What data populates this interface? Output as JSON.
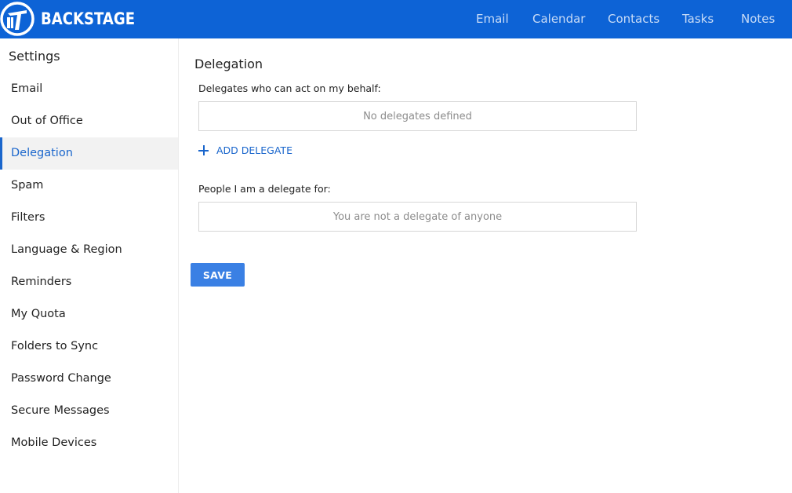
{
  "header": {
    "brand": "BACKSTAGE",
    "logo_icon": "backstage-logo-icon",
    "nav": [
      {
        "label": "Email"
      },
      {
        "label": "Calendar"
      },
      {
        "label": "Contacts"
      },
      {
        "label": "Tasks"
      },
      {
        "label": "Notes"
      }
    ],
    "bar_color": "#0d63d6"
  },
  "sidebar": {
    "title": "Settings",
    "items": [
      {
        "label": "Email"
      },
      {
        "label": "Out of Office"
      },
      {
        "label": "Delegation"
      },
      {
        "label": "Spam"
      },
      {
        "label": "Filters"
      },
      {
        "label": "Language & Region"
      },
      {
        "label": "Reminders"
      },
      {
        "label": "My Quota"
      },
      {
        "label": "Folders to Sync"
      },
      {
        "label": "Password Change"
      },
      {
        "label": "Secure Messages"
      },
      {
        "label": "Mobile Devices"
      }
    ],
    "active_item": "Delegation",
    "active_color": "#1a66cc"
  },
  "main": {
    "title": "Delegation",
    "delegates_label": "Delegates who can act on my behalf:",
    "delegates_empty": "No delegates defined",
    "add_delegate_label": "ADD DELEGATE",
    "add_icon": "plus-icon",
    "delegate_for_label": "People I am a delegate for:",
    "delegate_for_empty": "You are not a delegate of anyone",
    "save_label": "SAVE",
    "save_color": "#3a80e4"
  }
}
